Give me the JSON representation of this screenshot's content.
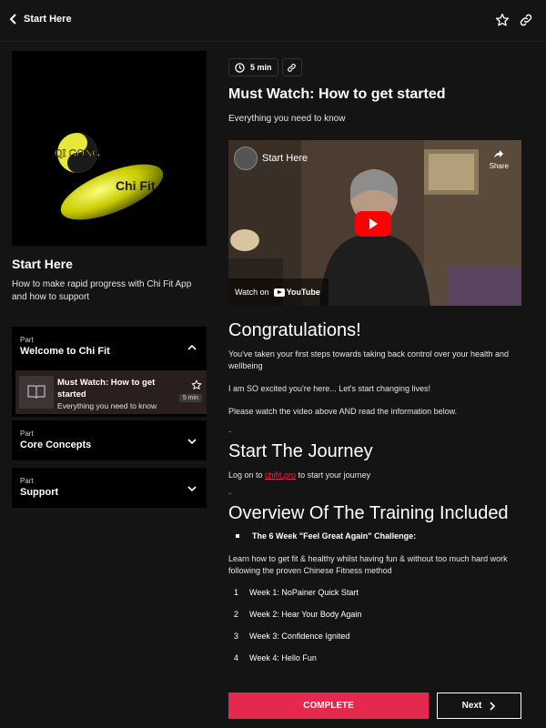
{
  "header": {
    "back_label": "Start Here",
    "icons": [
      "star-outline-icon",
      "link-icon"
    ]
  },
  "course": {
    "cover_logo_text": "QI GONG",
    "cover_brand": "Chi Fit",
    "title": "Start Here",
    "description": "How to make rapid progress with Chi Fit App and how to support"
  },
  "parts": [
    {
      "kicker": "Part",
      "name": "Welcome to Chi Fit",
      "expanded": true,
      "lessons": [
        {
          "title": "Must Watch: How to get started",
          "subtitle": "Everything you need to know",
          "duration": "5 min"
        }
      ]
    },
    {
      "kicker": "Part",
      "name": "Core Concepts",
      "expanded": false
    },
    {
      "kicker": "Part",
      "name": "Support",
      "expanded": false
    }
  ],
  "lesson": {
    "duration": "5 min",
    "title": "Must Watch: How to get started",
    "subtitle": "Everything you need to know",
    "video": {
      "title": "Start Here",
      "share_label": "Share",
      "watch_on": "Watch on",
      "platform": "YouTube"
    },
    "congrats_heading": "Congratulations!",
    "congrats_p1": "You've taken your first steps towards taking back control over your health and wellbeing",
    "congrats_p2": "I am SO excited you're here... Let's start changing lives!",
    "congrats_p3": "Please watch the video above AND read the information below.",
    "dash1": "-",
    "journey_heading": "Start The Journey",
    "journey_pre": "Log on to ",
    "journey_link": "chifit.pro",
    "journey_post": " to start your journey",
    "dash2": "-",
    "overview_heading": "Overview Of The Training Included",
    "bullet": "The 6 Week \"Feel Great Again\" Challenge:",
    "overview_p": "Learn how to get fit & healthy whilst having fun & without too much hard work following the proven Chinese Fitness method",
    "weeks": [
      {
        "num": "1",
        "text": "Week 1: NoPainer Quick Start"
      },
      {
        "num": "2",
        "text": "Week 2: Hear Your Body Again"
      },
      {
        "num": "3",
        "text": "Week 3: Confidence Ignited"
      },
      {
        "num": "4",
        "text": "Week 4: Hello Fun"
      }
    ]
  },
  "footer": {
    "complete_label": "COMPLETE",
    "next_label": "Next"
  },
  "colors": {
    "accent": "#e5294e",
    "background": "#141414",
    "panel": "#000000",
    "active_lesson": "#2b1e1f"
  }
}
